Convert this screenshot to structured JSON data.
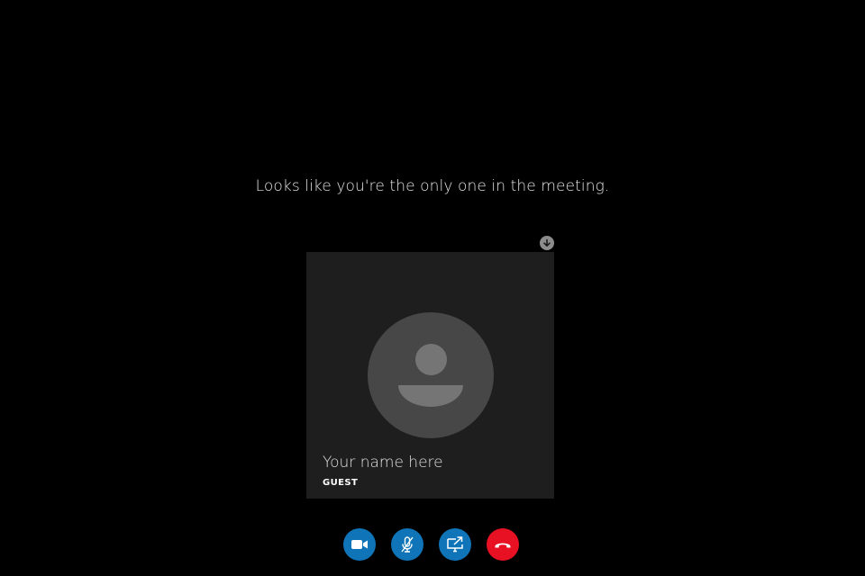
{
  "meeting": {
    "empty_message": "Looks like you're the only one in the meeting."
  },
  "participant": {
    "name": "Your name here",
    "role": "GUEST"
  },
  "controls": {
    "video": {
      "icon": "video-camera-icon",
      "color": "#0f75b8"
    },
    "mic": {
      "icon": "microphone-muted-icon",
      "color": "#0f75b8"
    },
    "share": {
      "icon": "screen-share-icon",
      "color": "#0f75b8"
    },
    "hangup": {
      "icon": "hang-up-icon",
      "color": "#e81123"
    }
  },
  "colors": {
    "background": "#000000",
    "tile": "#1e1e1e",
    "avatar_bg": "#474747",
    "avatar_fg": "#757575",
    "accent_blue": "#0f75b8",
    "hangup_red": "#e81123"
  }
}
